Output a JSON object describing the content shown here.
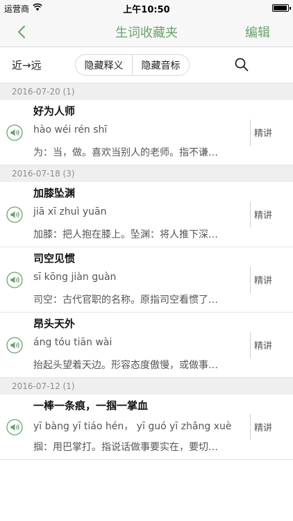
{
  "status_bar": {
    "carrier": "运营商",
    "time": "上午10:50"
  },
  "nav": {
    "title": "生词收藏夹",
    "edit_label": "编辑"
  },
  "filter": {
    "sort_label": "近→远",
    "hide_definition_label": "隐藏释义",
    "hide_pinyin_label": "隐藏音标"
  },
  "explain_label": "精讲",
  "groups": [
    {
      "date": "2016-07-20 (1)",
      "entries": [
        {
          "word": "好为人师",
          "pinyin": "hào wéi rén shī",
          "definition": "为：当，做。喜欢当别人的老师。指不谦…"
        }
      ]
    },
    {
      "date": "2016-07-18 (3)",
      "entries": [
        {
          "word": "加膝坠渊",
          "pinyin": "jiā xī zhuì yuān",
          "definition": "加膝：把人抱在膝上。坠渊：将人推下深…"
        },
        {
          "word": "司空见惯",
          "pinyin": "sī kōng jiàn guàn",
          "definition": "司空：古代官职的名称。原指司空看惯了…"
        },
        {
          "word": "昂头天外",
          "pinyin": "áng tóu tiān wài",
          "definition": "抬起头望着天边。形容态度傲慢，或做事…"
        }
      ]
    },
    {
      "date": "2016-07-12 (1)",
      "entries": [
        {
          "word": "一棒一条痕，一掴一掌血",
          "pinyin": "yī bàng yī tiáo hén， yī guó yī zhǎng xuè",
          "definition": "掴：用巴掌打。指说话做事要实在，要切…"
        }
      ]
    }
  ],
  "colors": {
    "accent": "#6aa36d",
    "header_bg": "#f7f7f7",
    "section_bg": "#efefef"
  },
  "icons": {
    "back": "chevron-left-icon",
    "search": "search-icon",
    "audio": "speaker-icon",
    "wifi": "wifi-icon",
    "battery": "battery-icon"
  }
}
